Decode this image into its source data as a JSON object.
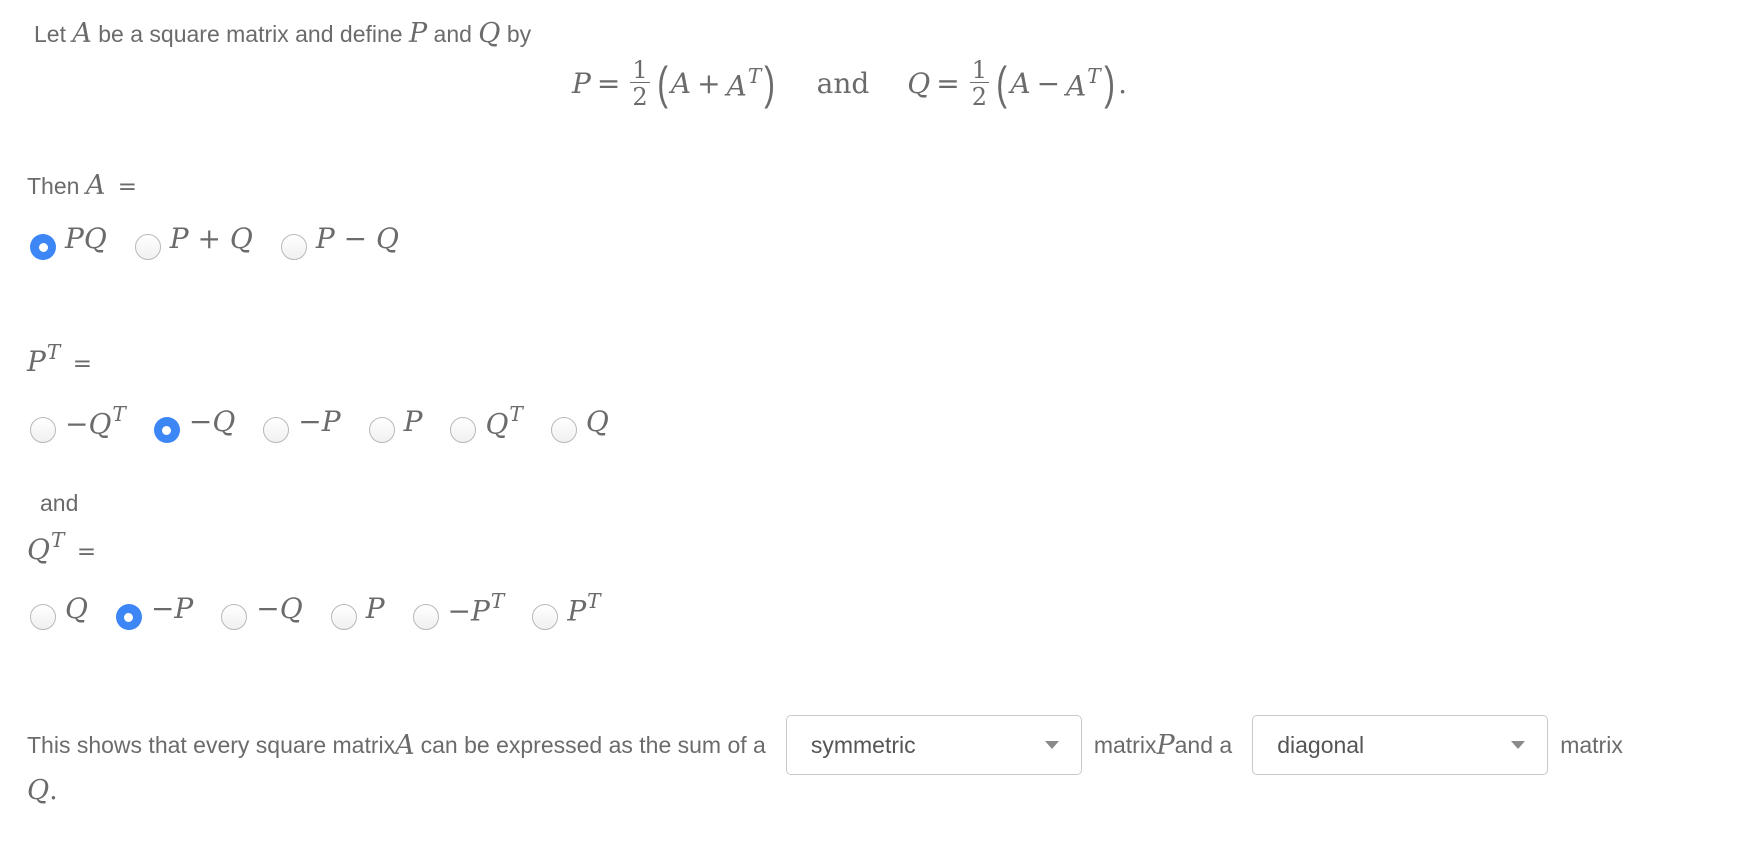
{
  "intro": {
    "text_1": "Let ",
    "var_A": "A",
    "text_2": " be a square matrix and define ",
    "var_P": "P",
    "text_3": " and ",
    "var_Q": "Q",
    "text_4": " by"
  },
  "definition": {
    "P": "P",
    "eq": "=",
    "num": "1",
    "den": "2",
    "lparen": "(",
    "rparen": ")",
    "A": "A",
    "plus": "+",
    "minus": "−",
    "T": "T",
    "and": "and",
    "Q": "Q",
    "period": "."
  },
  "question_1": {
    "prefix": "Then ",
    "lhs": "A",
    "eq": "=",
    "selected_index": 0,
    "options": [
      {
        "main": "PQ",
        "sup": ""
      },
      {
        "main": "P + Q",
        "sup": ""
      },
      {
        "main": "P − Q",
        "sup": ""
      }
    ]
  },
  "question_2": {
    "lhs": "P",
    "lhs_sup": "T",
    "eq": "=",
    "selected_index": 1,
    "options": [
      {
        "main": "−Q",
        "sup": "T"
      },
      {
        "main": "−Q",
        "sup": ""
      },
      {
        "main": "−P",
        "sup": ""
      },
      {
        "main": "P",
        "sup": ""
      },
      {
        "main": "Q",
        "sup": "T"
      },
      {
        "main": "Q",
        "sup": ""
      }
    ]
  },
  "connector": "and",
  "question_3": {
    "lhs": "Q",
    "lhs_sup": "T",
    "eq": "=",
    "selected_index": 1,
    "options": [
      {
        "main": "Q",
        "sup": ""
      },
      {
        "main": "−P",
        "sup": ""
      },
      {
        "main": "−Q",
        "sup": ""
      },
      {
        "main": "P",
        "sup": ""
      },
      {
        "main": "−P",
        "sup": "T"
      },
      {
        "main": "P",
        "sup": "T"
      }
    ]
  },
  "conclusion": {
    "text_1": "This shows that every square matrix ",
    "var_A": "A",
    "text_2": " can be expressed as the sum of a",
    "select_1_value": "symmetric",
    "text_3": "matrix ",
    "var_P": "P",
    "text_4": " and a",
    "select_2_value": "diagonal",
    "text_5": "matrix",
    "var_Q": "Q",
    "period": "."
  },
  "colors": {
    "accent": "#3d86f5",
    "text": "#6b6b6b"
  }
}
